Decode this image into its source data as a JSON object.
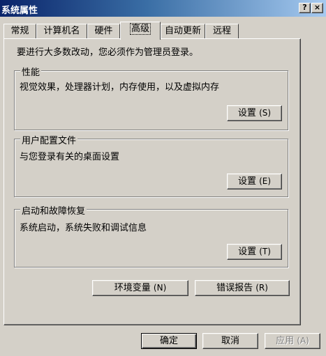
{
  "window": {
    "title": "系统属性",
    "help_button": "?",
    "close_button": "×"
  },
  "tabs": [
    {
      "label": "常规",
      "active": false
    },
    {
      "label": "计算机名",
      "active": false
    },
    {
      "label": "硬件",
      "active": false
    },
    {
      "label": "高级",
      "active": true
    },
    {
      "label": "自动更新",
      "active": false
    },
    {
      "label": "远程",
      "active": false
    }
  ],
  "advanced": {
    "intro": "要进行大多数改动，您必须作为管理员登录。",
    "performance": {
      "legend": "性能",
      "description": "视觉效果，处理器计划，内存使用，以及虚拟内存",
      "settings_label": "设置",
      "settings_mnemonic": "(S)"
    },
    "user_profiles": {
      "legend": "用户配置文件",
      "description": "与您登录有关的桌面设置",
      "settings_label": "设置",
      "settings_mnemonic": "(E)"
    },
    "startup_recovery": {
      "legend": "启动和故障恢复",
      "description": "系统启动，系统失败和调试信息",
      "settings_label": "设置",
      "settings_mnemonic": "(T)"
    },
    "environment_variables_label": "环境变量",
    "environment_variables_mnemonic": "(N)",
    "error_reporting_label": "错误报告",
    "error_reporting_mnemonic": "(R)"
  },
  "footer": {
    "ok_label": "确定",
    "cancel_label": "取消",
    "apply_label": "应用",
    "apply_mnemonic": "(A)"
  },
  "colors": {
    "face": "#d4d0c8",
    "title_start": "#0a246a",
    "title_end": "#a6caf0",
    "disabled_text": "#808080"
  }
}
